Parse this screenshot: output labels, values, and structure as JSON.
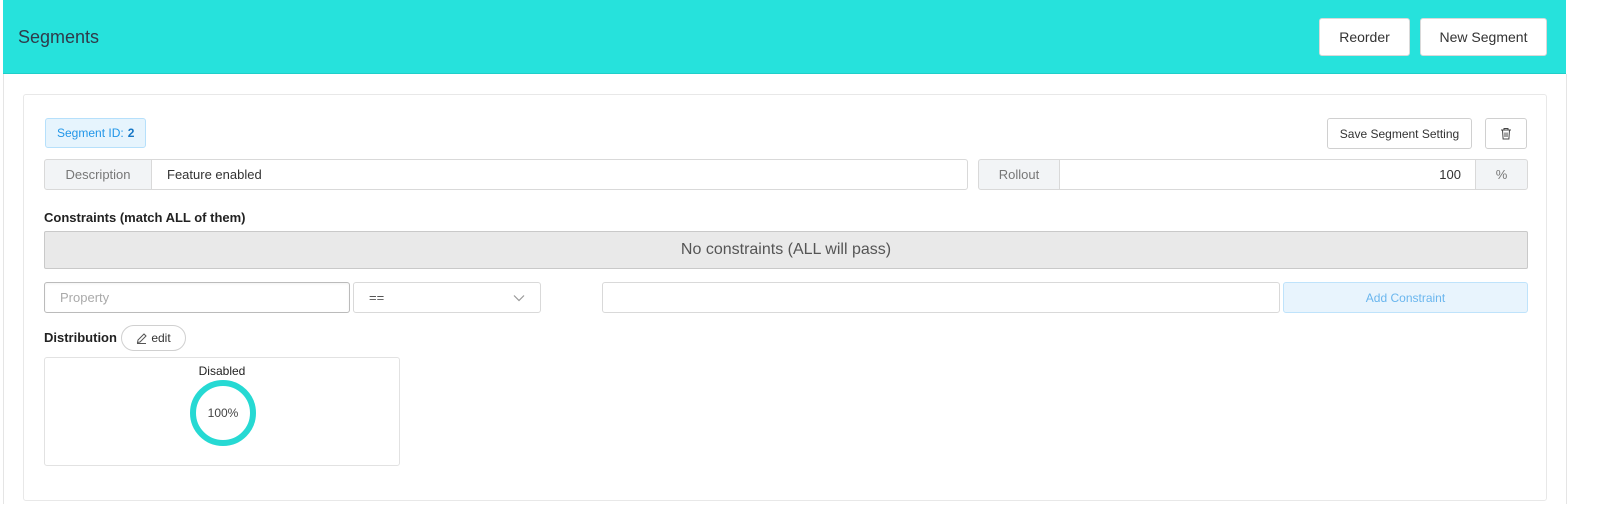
{
  "header": {
    "title": "Segments",
    "reorder_label": "Reorder",
    "new_segment_label": "New Segment"
  },
  "segment": {
    "id_label": "Segment ID:",
    "id_value": "2",
    "save_label": "Save Segment Setting",
    "trash_icon": "trash-icon",
    "description_label": "Description",
    "description_value": "Feature enabled",
    "rollout_label": "Rollout",
    "rollout_value": "100",
    "rollout_unit": "%"
  },
  "constraints": {
    "title": "Constraints (match ALL of them)",
    "empty_message": "No constraints (ALL will pass)",
    "property_placeholder": "Property",
    "operator_value": "==",
    "value_input": "",
    "add_label": "Add Constraint"
  },
  "distribution": {
    "title": "Distribution",
    "edit_label": "edit",
    "items": [
      {
        "variant": "Disabled",
        "percent": "100%",
        "percent_value": 100
      }
    ]
  },
  "colors": {
    "header_bg": "#26e2dc",
    "donut": "#26d9d3",
    "accent_blue": "#2196e8"
  }
}
